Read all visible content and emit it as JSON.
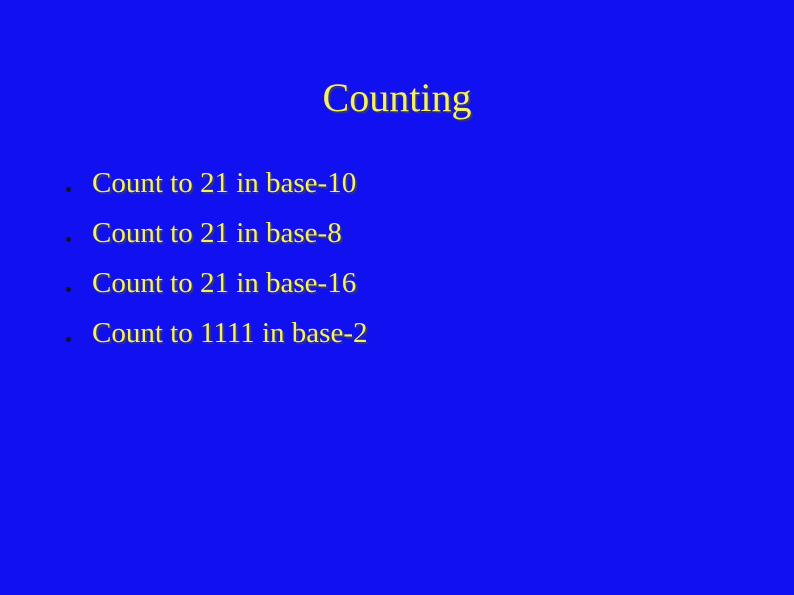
{
  "slide": {
    "title": "Counting",
    "bullets": [
      {
        "text": "Count to 21 in base-10"
      },
      {
        "text": "Count to 21 in base-8"
      },
      {
        "text": "Count to 21 in base-16"
      },
      {
        "text": "Count to 1111 in base-2"
      }
    ],
    "colors": {
      "background": "#1010f0",
      "text": "#f5f06a"
    }
  }
}
